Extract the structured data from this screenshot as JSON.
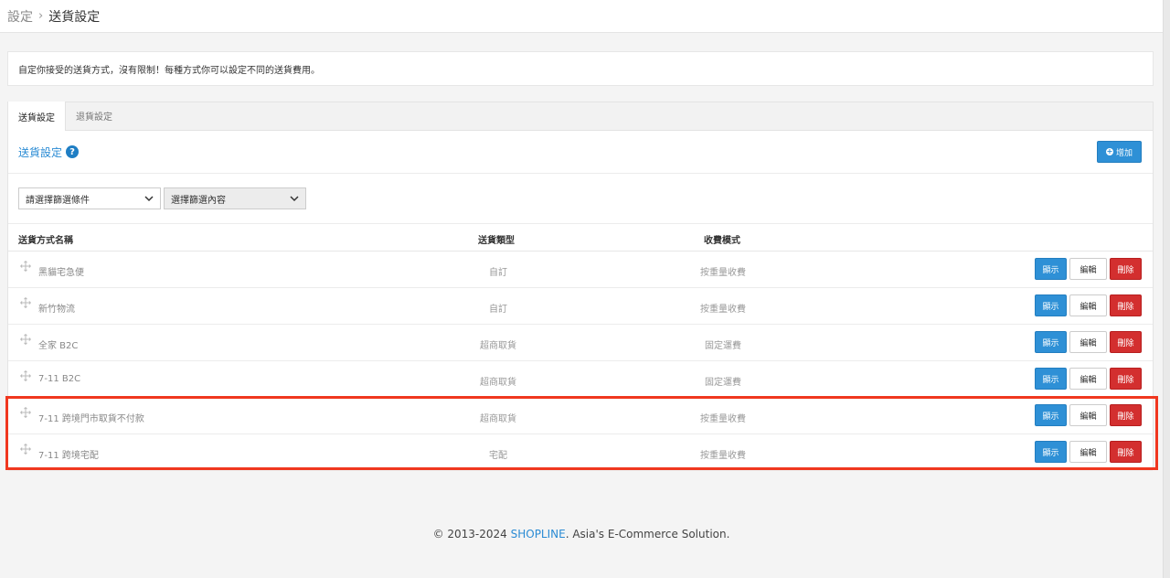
{
  "breadcrumb": {
    "parent": "設定",
    "separator": "›",
    "current": "送貨設定"
  },
  "info": {
    "text": "自定你接受的送貨方式，沒有限制！每種方式你可以設定不同的送貨費用。"
  },
  "tabs": [
    {
      "label": "送貨設定",
      "active": true
    },
    {
      "label": "退貨設定",
      "active": false
    }
  ],
  "section": {
    "title": "送貨設定",
    "help": "?",
    "add_label": "增加"
  },
  "filters": {
    "condition": "請選擇篩選條件",
    "content": "選擇篩選內容"
  },
  "table": {
    "headers": {
      "name": "送貨方式名稱",
      "type": "送貨類型",
      "mode": "收費模式"
    },
    "rows": [
      {
        "name": "黑貓宅急便",
        "type": "自訂",
        "mode": "按重量收費"
      },
      {
        "name": "新竹物流",
        "type": "自訂",
        "mode": "按重量收費"
      },
      {
        "name": "全家 B2C",
        "type": "超商取貨",
        "mode": "固定運費"
      },
      {
        "name": "7-11 B2C",
        "type": "超商取貨",
        "mode": "固定運費"
      },
      {
        "name": "7-11 跨境門市取貨不付款",
        "type": "超商取貨",
        "mode": "按重量收費"
      },
      {
        "name": "7-11 跨境宅配",
        "type": "宅配",
        "mode": "按重量收費"
      }
    ],
    "actions": {
      "show": "顯示",
      "edit": "編輯",
      "delete": "刪除"
    }
  },
  "footer": {
    "prefix": "© 2013-2024 ",
    "brand": "SHOPLINE",
    "suffix": ". Asia's E-Commerce Solution."
  },
  "colors": {
    "accent": "#2e90d6",
    "danger": "#d32f2f",
    "highlight": "#f0371f"
  }
}
